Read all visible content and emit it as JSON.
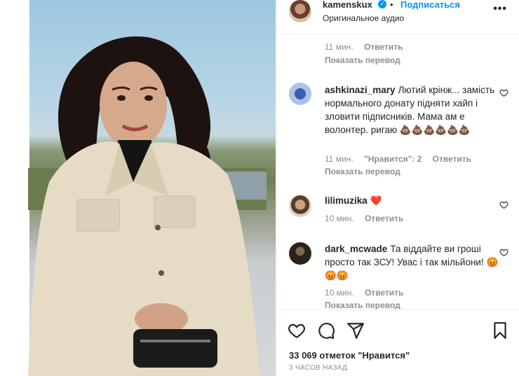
{
  "header": {
    "username": "kamenskux",
    "verified_icon": "✓",
    "separator": "•",
    "follow_label": "Подписаться",
    "audio": "Оригинальное аудио",
    "more_icon": "•••"
  },
  "top_meta": {
    "time": "11 мин.",
    "reply": "Ответить",
    "translate": "Показать перевод"
  },
  "comments": [
    {
      "user": "ashkinazi_mary",
      "text": "Лютий крінж... замість нормального донату підняти хайп і зловити підписників. Мама ам е волонтер. ригаю 💩💩💩💩💩💩",
      "time": "11 мин.",
      "likes": "\"Нравится\": 2",
      "reply": "Ответить",
      "translate": "Показать перевод"
    },
    {
      "user": "lilimuzika",
      "text": "❤️",
      "time": "10 мин.",
      "reply": "Ответить"
    },
    {
      "user": "dark_mcwade",
      "text": "Та віддайте ви гроші просто так ЗСУ! Увас і так мільйони! 😡😡😡",
      "time": "10 мин.",
      "reply": "Ответить",
      "translate": "Показать перевод"
    }
  ],
  "footer": {
    "likes": "33 069 отметок \"Нравится\"",
    "time_ago": "3 ЧАСОВ НАЗАД"
  },
  "colors": {
    "accent": "#0095f6",
    "muted": "#8e8e8e",
    "text": "#262626"
  },
  "icons": {
    "like": "heart-icon",
    "comment": "comment-icon",
    "share": "share-icon",
    "save": "bookmark-icon"
  }
}
